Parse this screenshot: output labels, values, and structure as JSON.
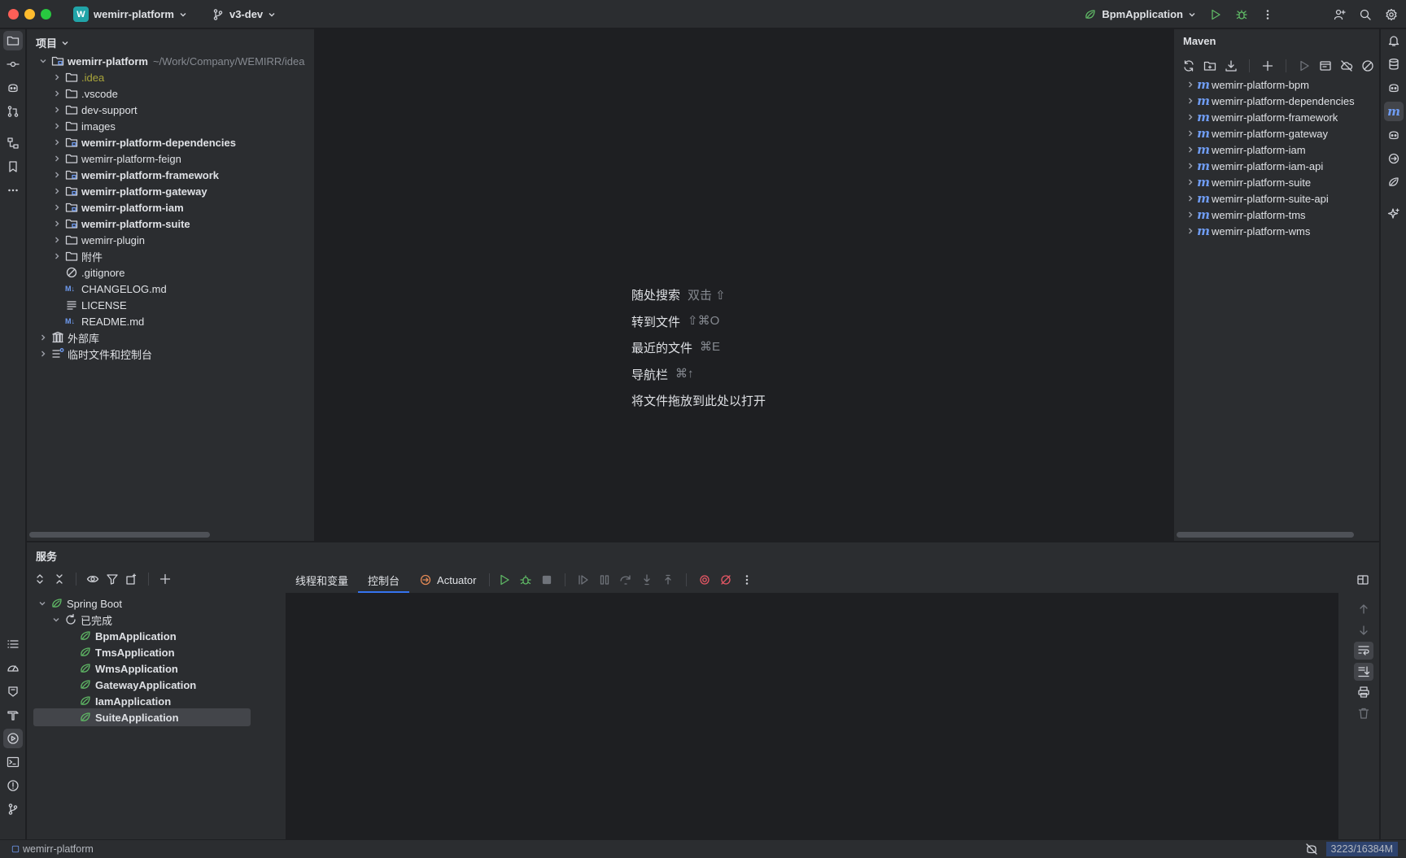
{
  "titlebar": {
    "project_badge": "W",
    "project_name": "wemirr-platform",
    "branch": "v3-dev",
    "run_config": "BpmApplication"
  },
  "project_panel": {
    "title": "项目",
    "root": {
      "name": "wemirr-platform",
      "path": "~/Work/Company/WEMIRR/idea"
    },
    "items": [
      {
        "label": ".idea",
        "type": "folder",
        "style": "idea"
      },
      {
        "label": ".vscode",
        "type": "folder",
        "style": "normal"
      },
      {
        "label": "dev-support",
        "type": "folder",
        "style": "normal"
      },
      {
        "label": "images",
        "type": "folder",
        "style": "normal"
      },
      {
        "label": "wemirr-platform-dependencies",
        "type": "module",
        "style": "bold"
      },
      {
        "label": "wemirr-platform-feign",
        "type": "folder",
        "style": "normal"
      },
      {
        "label": "wemirr-platform-framework",
        "type": "module",
        "style": "bold"
      },
      {
        "label": "wemirr-platform-gateway",
        "type": "module",
        "style": "bold"
      },
      {
        "label": "wemirr-platform-iam",
        "type": "module",
        "style": "bold"
      },
      {
        "label": "wemirr-platform-suite",
        "type": "module",
        "style": "bold"
      },
      {
        "label": "wemirr-plugin",
        "type": "folder",
        "style": "normal"
      },
      {
        "label": "附件",
        "type": "folder",
        "style": "normal"
      },
      {
        "label": ".gitignore",
        "type": "ignore",
        "style": "normal"
      },
      {
        "label": "CHANGELOG.md",
        "type": "md",
        "style": "normal"
      },
      {
        "label": "LICENSE",
        "type": "text",
        "style": "normal"
      },
      {
        "label": "README.md",
        "type": "md",
        "style": "normal"
      }
    ],
    "external_libs": "外部库",
    "scratches": "临时文件和控制台"
  },
  "editor": {
    "hints": [
      {
        "label": "随处搜索",
        "key": "双击 ⇧"
      },
      {
        "label": "转到文件",
        "key": "⇧⌘O"
      },
      {
        "label": "最近的文件",
        "key": "⌘E"
      },
      {
        "label": "导航栏",
        "key": "⌘↑"
      },
      {
        "label": "将文件拖放到此处以打开",
        "key": ""
      }
    ]
  },
  "maven": {
    "title": "Maven",
    "projects": [
      "wemirr-platform-bpm",
      "wemirr-platform-dependencies",
      "wemirr-platform-framework",
      "wemirr-platform-gateway",
      "wemirr-platform-iam",
      "wemirr-platform-iam-api",
      "wemirr-platform-suite",
      "wemirr-platform-suite-api",
      "wemirr-platform-tms",
      "wemirr-platform-wms"
    ]
  },
  "services": {
    "title": "服务",
    "group": "Spring Boot",
    "status_group": "已完成",
    "apps": [
      "BpmApplication",
      "TmsApplication",
      "WmsApplication",
      "GatewayApplication",
      "IamApplication",
      "SuiteApplication"
    ],
    "selected_app": "SuiteApplication",
    "tabs": [
      "线程和变量",
      "控制台",
      "Actuator"
    ],
    "active_tab": "控制台"
  },
  "statusbar": {
    "project": "wemirr-platform",
    "memory": "3223/16384M"
  },
  "colors": {
    "accent": "#3574f0",
    "run_green": "#5fb865",
    "stop_red": "#e55765",
    "module_blue": "#6f9cf2"
  }
}
